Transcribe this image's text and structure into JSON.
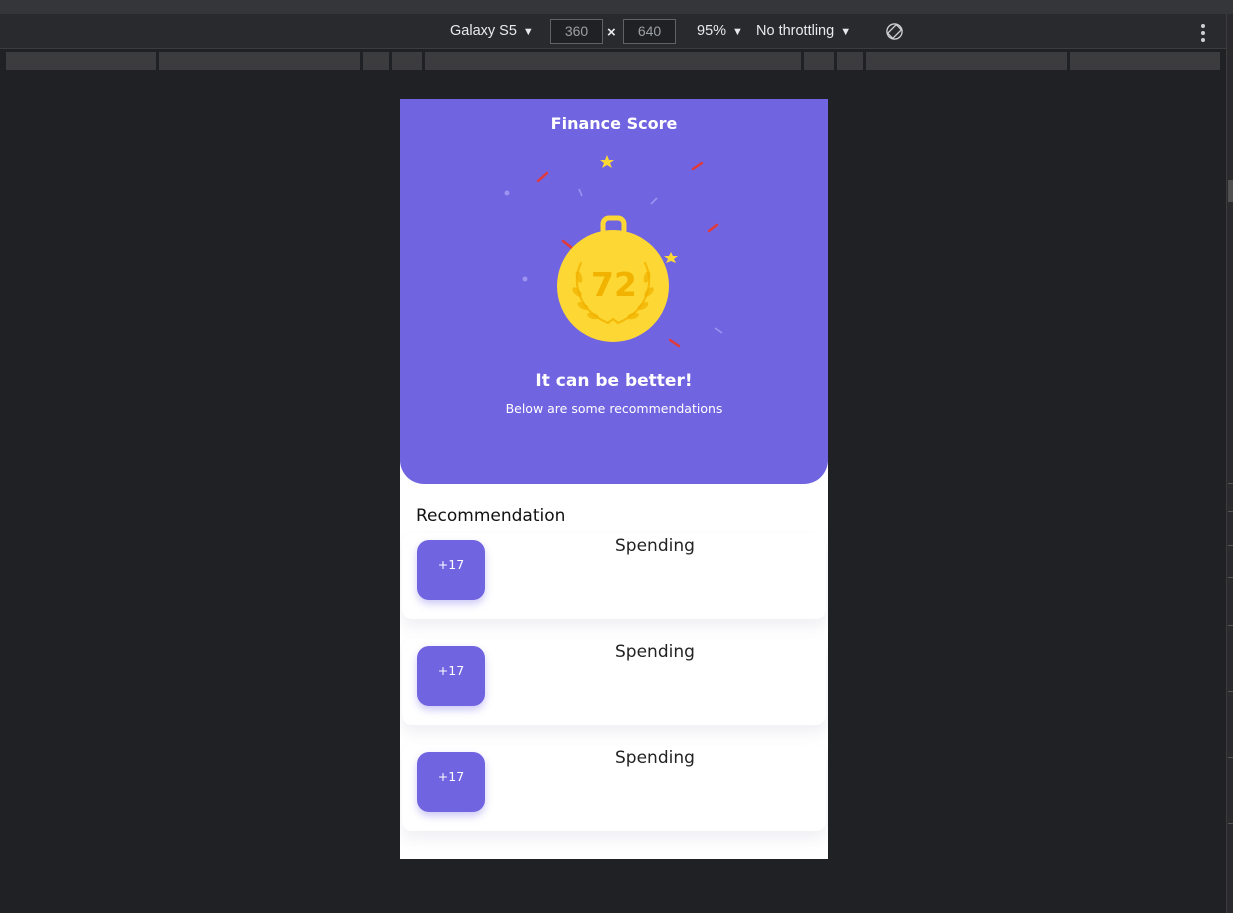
{
  "devtools": {
    "device": "Galaxy S5",
    "width": "360",
    "height": "640",
    "times": "×",
    "zoom": "95%",
    "throttling": "No throttling",
    "rotate_icon": "rotate-device-icon",
    "menu_icon": "more-vertical-icon"
  },
  "app": {
    "title": "Finance Score",
    "score": "72",
    "heading": "It can be better!",
    "subtitle": "Below are some recommendations",
    "accent_color": "#7164e1",
    "medal_color": "#fdd835",
    "recommendations_title": "Recommendation",
    "recommendations": [
      {
        "badge": "+17",
        "title": "Spending"
      },
      {
        "badge": "+17",
        "title": "Spending"
      },
      {
        "badge": "+17",
        "title": "Spending"
      }
    ]
  }
}
